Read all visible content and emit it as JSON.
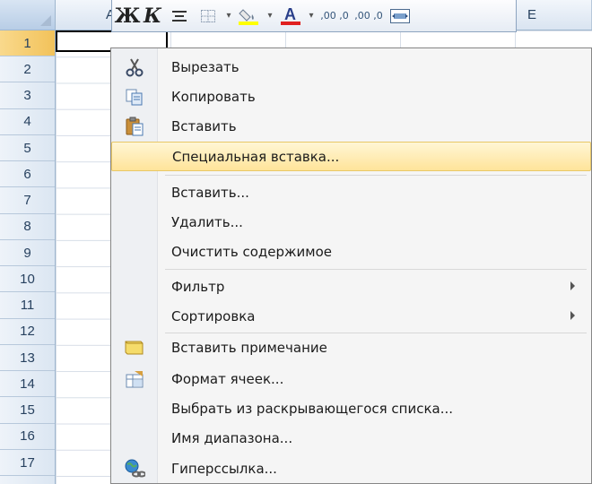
{
  "spreadsheet": {
    "column_headers": [
      "",
      "A",
      "",
      "",
      "E"
    ],
    "row_numbers": [
      "1",
      "2",
      "3",
      "4",
      "5",
      "6",
      "7",
      "8",
      "9",
      "10",
      "11",
      "12",
      "13",
      "14",
      "15",
      "16",
      "17"
    ],
    "active_row": "1"
  },
  "mini_toolbar": {
    "bold": "Ж",
    "italic": "К",
    "decrease_decimal": ",00 ,0",
    "increase_decimal": ",00 ,0"
  },
  "context_menu": {
    "items": [
      {
        "label": "Вырезать",
        "icon": "scissors-icon"
      },
      {
        "label": "Копировать",
        "icon": "copy-icon"
      },
      {
        "label": "Вставить",
        "icon": "paste-icon"
      },
      {
        "label": "Специальная вставка...",
        "icon": "",
        "highlighted": true
      },
      {
        "label": "Вставить...",
        "icon": ""
      },
      {
        "label": "Удалить...",
        "icon": ""
      },
      {
        "label": "Очистить содержимое",
        "icon": ""
      },
      {
        "label": "Фильтр",
        "icon": "",
        "submenu": true
      },
      {
        "label": "Сортировка",
        "icon": "",
        "submenu": true
      },
      {
        "label": "Вставить примечание",
        "icon": "comment-icon"
      },
      {
        "label": "Формат ячеек...",
        "icon": "format-cells-icon"
      },
      {
        "label": "Выбрать из раскрывающегося списка...",
        "icon": ""
      },
      {
        "label": "Имя диапазона...",
        "icon": ""
      },
      {
        "label": "Гиперссылка...",
        "icon": "hyperlink-icon"
      }
    ]
  },
  "colors": {
    "highlight": "#ffe49a",
    "font_color_underline": "#e02020",
    "fill_color_underline": "#ffff00"
  }
}
